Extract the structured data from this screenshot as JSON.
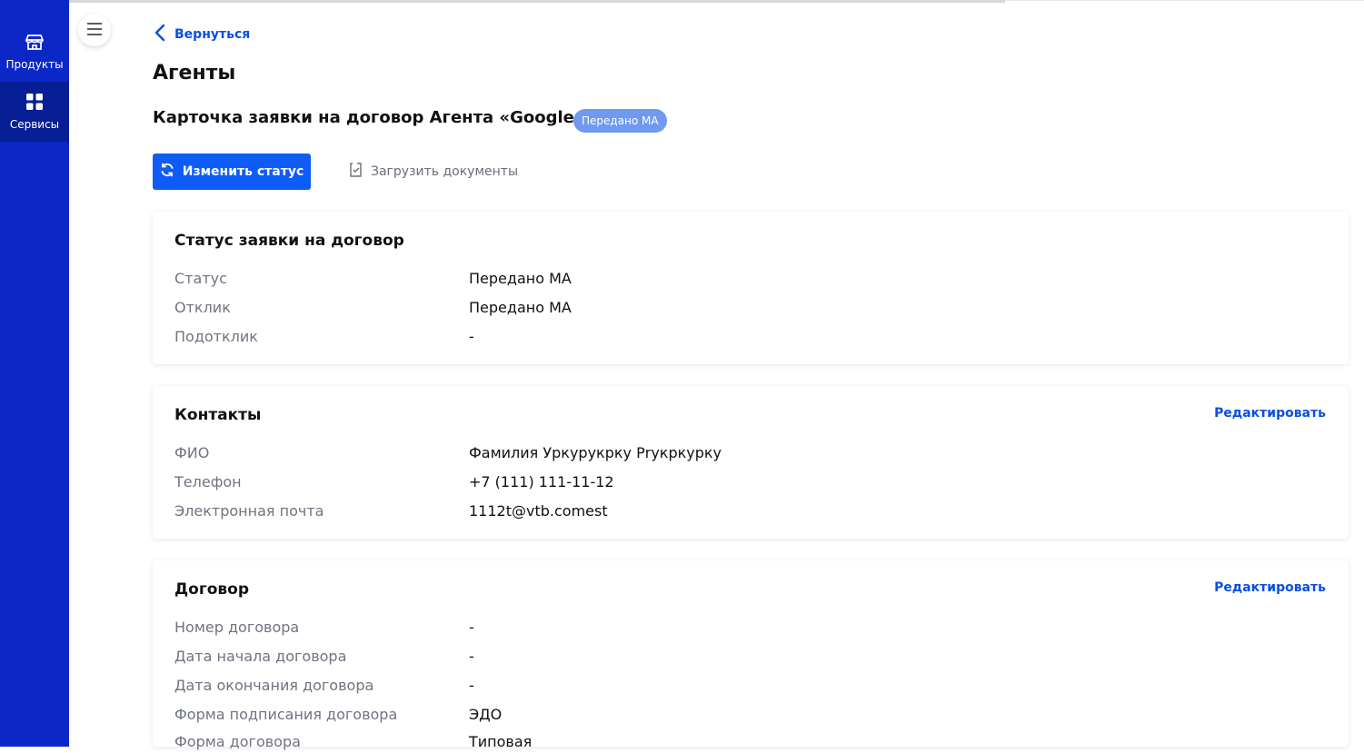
{
  "sidebar": {
    "items": [
      {
        "label": "Продукты",
        "icon": "store-icon"
      },
      {
        "label": "Сервисы",
        "icon": "grid-icon"
      }
    ]
  },
  "header": {
    "back_label": "Вернуться",
    "page_title": "Агенты",
    "card_title": "Карточка заявки на договор Агента «Google»",
    "status_badge": "Передано МА"
  },
  "actions": {
    "change_status": "Изменить статус",
    "upload_docs": "Загрузить документы"
  },
  "sections": {
    "status": {
      "title": "Статус заявки на договор",
      "rows": [
        {
          "label": "Статус",
          "value": "Передано МА"
        },
        {
          "label": "Отклик",
          "value": "Передано МА"
        },
        {
          "label": "Подотклик",
          "value": "-"
        }
      ]
    },
    "contacts": {
      "title": "Контакты",
      "edit": "Редактировать",
      "rows": [
        {
          "label": "ФИО",
          "value": "Фамилия Уркурукрку Рrукркурку"
        },
        {
          "label": "Телефон",
          "value": "+7 (111) 111-11-12"
        },
        {
          "label": "Электронная почта",
          "value": "1112t@vtb.comest"
        }
      ]
    },
    "contract": {
      "title": "Договор",
      "edit": "Редактировать",
      "rows": [
        {
          "label": "Номер договора",
          "value": "-"
        },
        {
          "label": "Дата начала договора",
          "value": "-"
        },
        {
          "label": "Дата окончания договора",
          "value": "-"
        },
        {
          "label": "Форма подписания договора",
          "value": "ЭДО"
        },
        {
          "label": "Форма договора",
          "value": "Типовая"
        }
      ]
    }
  },
  "colors": {
    "sidebar": "#0b28c7",
    "sidebar_active": "#081e94",
    "primary": "#0d5cf6",
    "link": "#0a4fe0",
    "badge": "#6f9af0"
  }
}
